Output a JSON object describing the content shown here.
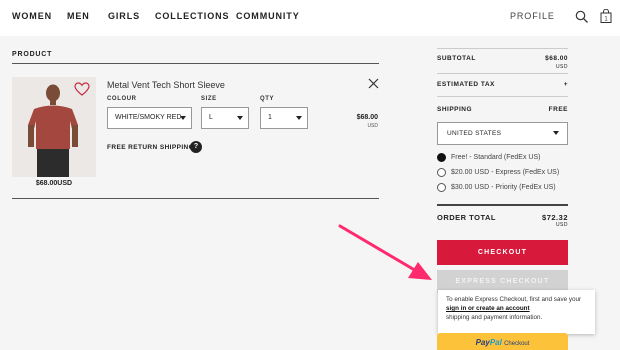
{
  "nav": {
    "left_items": [
      "WOMEN",
      "MEN",
      "GIRLS",
      "COLLECTIONS",
      "COMMUNITY"
    ],
    "profile_label": "PROFILE",
    "bag_count": "1"
  },
  "cart": {
    "section_label": "PRODUCT",
    "item": {
      "name": "Metal Vent Tech Short Sleeve",
      "colour_label": "COLOUR",
      "colour_value": "WHITE/SMOKY RED",
      "size_label": "SIZE",
      "size_value": "L",
      "qty_label": "QTY",
      "qty_value": "1",
      "line_price": "$68.00",
      "line_currency": "USD",
      "photo_price": "$68.00USD",
      "free_return": "FREE RETURN SHIPPING",
      "help_glyph": "?"
    }
  },
  "summary": {
    "subtotal_label": "SUBTOTAL",
    "subtotal_value": "$68.00",
    "subtotal_currency": "USD",
    "tax_label": "ESTIMATED TAX",
    "tax_value": "+",
    "shipping_label": "SHIPPING",
    "shipping_value": "FREE",
    "country": "UNITED STATES",
    "shipping_options": [
      {
        "label": "Free! - Standard (FedEx US)",
        "selected": true
      },
      {
        "label": "$20.00 USD - Express (FedEx US)",
        "selected": false
      },
      {
        "label": "$30.00 USD - Priority (FedEx US)",
        "selected": false
      }
    ],
    "total_label": "ORDER TOTAL",
    "total_value": "$72.32",
    "total_currency": "USD",
    "checkout_label": "CHECKOUT",
    "express_label": "EXPRESS CHECKOUT",
    "tooltip_line1": "To enable Express Checkout, first and save your",
    "tooltip_link": "sign in or create an account",
    "tooltip_line3": "shipping and payment information.",
    "paypal_part1": "Pay",
    "paypal_part2": "Pal",
    "paypal_suffix": "Checkout"
  },
  "colors": {
    "checkout_red": "#d7193b",
    "paypal_yellow": "#fcc33a",
    "arrow_pink": "#ff2a6d"
  }
}
